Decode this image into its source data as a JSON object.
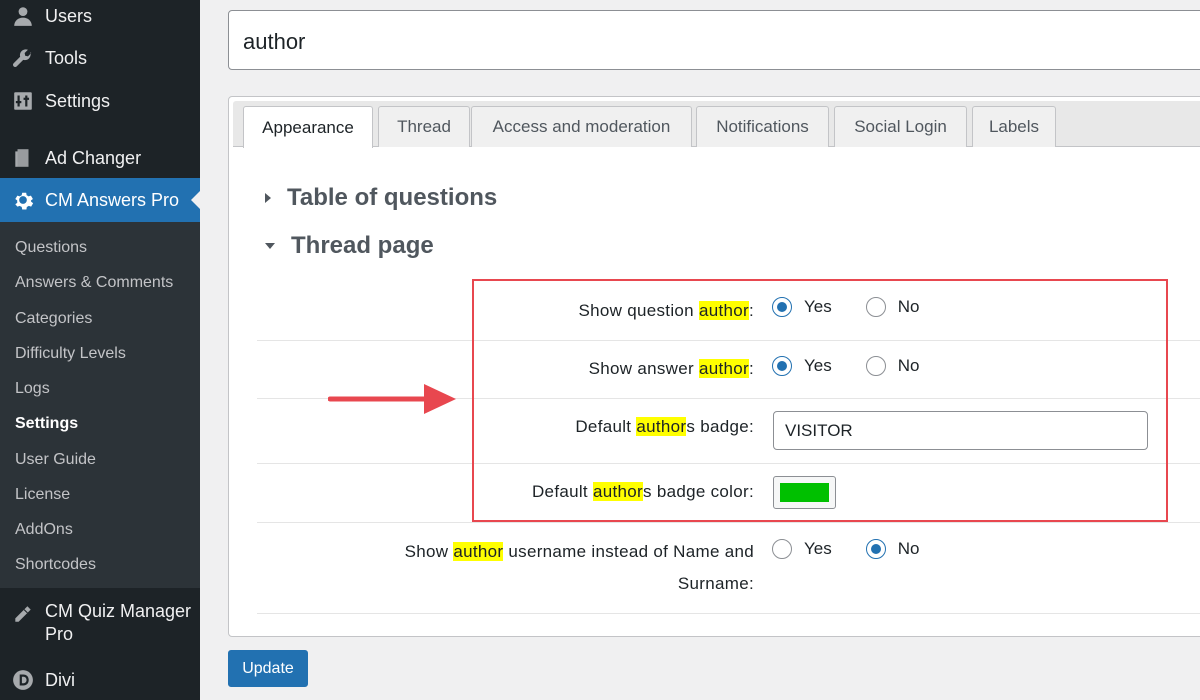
{
  "sidebar": {
    "top_items": [
      {
        "label": "Users",
        "icon": "users-icon"
      },
      {
        "label": "Tools",
        "icon": "wrench-icon"
      },
      {
        "label": "Settings",
        "icon": "settings-icon"
      },
      {
        "label": "Ad Changer",
        "icon": "ad-changer-icon"
      },
      {
        "label": "CM Answers Pro",
        "icon": "gear-icon"
      }
    ],
    "submenu": [
      "Questions",
      "Answers & Comments",
      "Categories",
      "Difficulty Levels",
      "Logs",
      "Settings",
      "User Guide",
      "License",
      "AddOns",
      "Shortcodes"
    ],
    "bottom_items": [
      {
        "label": "CM Quiz Manager Pro",
        "line1": "CM Quiz Manager",
        "line2": "Pro",
        "icon": "pencil-ruler-icon"
      },
      {
        "label": "Divi",
        "icon": "divi-icon"
      }
    ]
  },
  "search": {
    "value": "author"
  },
  "tabs": [
    "Appearance",
    "Thread",
    "Access and moderation",
    "Notifications",
    "Social Login",
    "Labels"
  ],
  "sections": {
    "table_of_questions": "Table of questions",
    "thread_page": "Thread page"
  },
  "settings": {
    "show_question_author": {
      "pre": "Show question ",
      "hl": "author",
      "post": ":",
      "value": "Yes"
    },
    "show_answer_author": {
      "pre": "Show answer ",
      "hl": "author",
      "post": ":",
      "value": "Yes"
    },
    "default_badge": {
      "pre": "Default ",
      "hl": "author",
      "post": "s badge:",
      "value": "VISITOR"
    },
    "default_badge_color": {
      "pre": "Default ",
      "hl": "author",
      "post": "s badge color:",
      "color": "#00c000"
    },
    "show_author_username": {
      "pre": "Show ",
      "hl": "author",
      "post1": " username instead of Name and",
      "post2": "Surname:",
      "value": "No"
    }
  },
  "radio_labels": {
    "yes": "Yes",
    "no": "No"
  },
  "buttons": {
    "update": "Update"
  },
  "colors": {
    "accent": "#2271b1",
    "highlight_box": "#e8474f",
    "highlight_text": "#ffff00"
  }
}
